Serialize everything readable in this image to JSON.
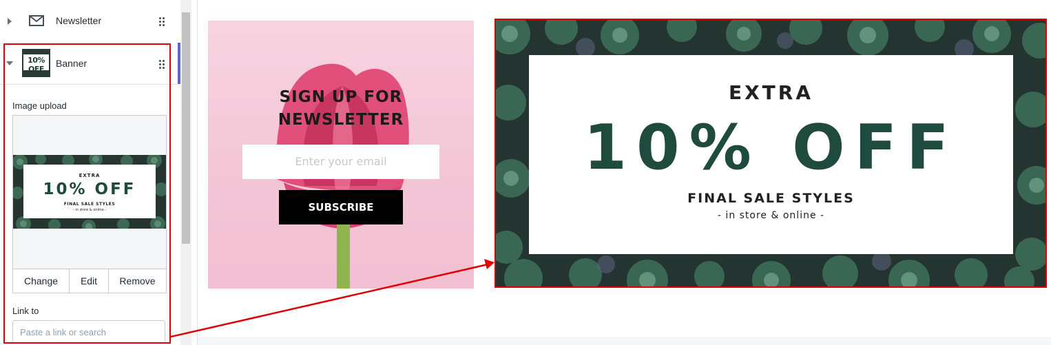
{
  "sidebar": {
    "sections": [
      {
        "label": "Newsletter",
        "icon": "mail-icon",
        "expanded": false
      },
      {
        "label": "Banner",
        "icon": "banner-thumbnail",
        "expanded": true
      }
    ],
    "banner_settings": {
      "image_label": "Image upload",
      "thumbnail_text": "10% OFF",
      "image_actions": [
        "Change",
        "Edit",
        "Remove"
      ],
      "link_label": "Link to",
      "link_placeholder": "Paste a link or search"
    }
  },
  "preview": {
    "newsletter": {
      "title_line1": "SIGN UP FOR",
      "title_line2": "NEWSLETTER",
      "email_placeholder": "Enter your email",
      "button_label": "SUBSCRIBE"
    },
    "banner": {
      "extra": "EXTRA",
      "discount": "10% OFF",
      "subtitle": "FINAL SALE STYLES",
      "tagline": "- in store & online -"
    }
  },
  "colors": {
    "annotation": "#e00000",
    "active_indicator": "#5c6ac4",
    "banner_text_fill": "#1f4a3e"
  }
}
